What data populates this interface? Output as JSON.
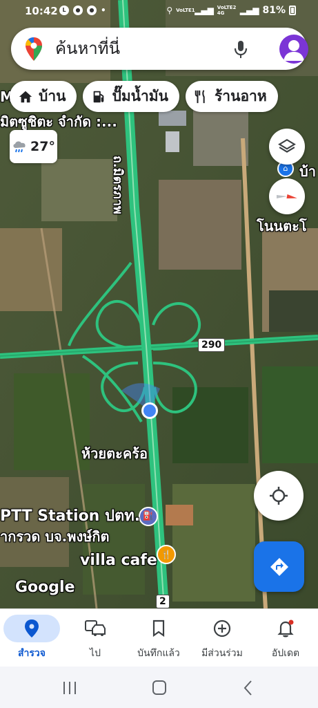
{
  "status_bar": {
    "time": "10:42",
    "carrier1": "VoLTE1",
    "carrier2": "VoLTE2 4G",
    "battery": "81%"
  },
  "search": {
    "placeholder": "ค้นหาที่นี่"
  },
  "chips": [
    {
      "label": "บ้าน",
      "icon": "home-icon"
    },
    {
      "label": "ปั๊มน้ำมัน",
      "icon": "gas-station-icon"
    },
    {
      "label": "ร้านอาห",
      "icon": "restaurant-icon"
    }
  ],
  "weather": {
    "temperature": "27°",
    "icon": "rain-cloud-icon"
  },
  "map": {
    "labels": {
      "business_top": "MC",
      "business_company": "มิตซูชิตะ จำกัด :...",
      "road_name": "ถ.มิตรภาพ",
      "place_right": "บ้า",
      "village_right": "โนนตะโ",
      "village_center": "ห้วยตะคร้อ",
      "ptt_station": "PTT Station ปตท.",
      "ptt_sub": "ากรวด บจ.พงษ์กิต",
      "villa_cafe": "villa cafe",
      "google": "Google"
    },
    "road_shields": {
      "route_290": "290",
      "route_2": "2"
    }
  },
  "bottom_nav": [
    {
      "label": "สำรวจ",
      "active": true
    },
    {
      "label": "ไป",
      "active": false
    },
    {
      "label": "บันทึกแล้ว",
      "active": false
    },
    {
      "label": "มีส่วนร่วม",
      "active": false
    },
    {
      "label": "อัปเดต",
      "active": false
    }
  ],
  "colors": {
    "accent": "#1a73e8",
    "active_nav_bg": "#d3e3fd",
    "route_green": "#2ec27e",
    "avatar": "#7b35d6"
  }
}
